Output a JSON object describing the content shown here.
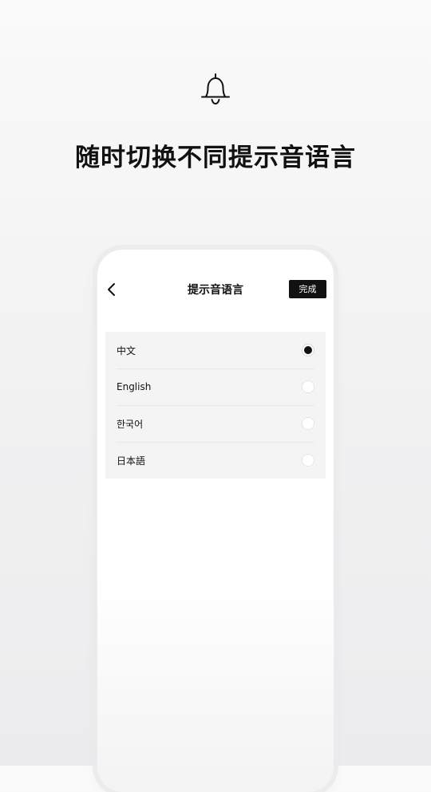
{
  "promo": {
    "headline": "随时切换不同提示音语言",
    "icon": "bell-icon"
  },
  "screen": {
    "title": "提示音语言",
    "back_icon": "chevron-left-icon",
    "done_label": "完成",
    "languages": [
      {
        "label": "中文",
        "selected": true
      },
      {
        "label": "English",
        "selected": false
      },
      {
        "label": "한국어",
        "selected": false
      },
      {
        "label": "日本語",
        "selected": false
      }
    ]
  },
  "colors": {
    "accent": "#111111",
    "list_background": "#f4f4f4"
  }
}
